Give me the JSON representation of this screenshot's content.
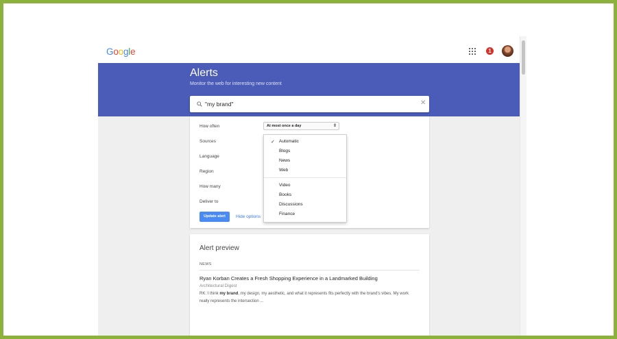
{
  "header": {
    "logo_letters": [
      {
        "char": "G",
        "color": "#4285f4"
      },
      {
        "char": "o",
        "color": "#ea4335"
      },
      {
        "char": "o",
        "color": "#fbbc05"
      },
      {
        "char": "g",
        "color": "#4285f4"
      },
      {
        "char": "l",
        "color": "#34a853"
      },
      {
        "char": "e",
        "color": "#ea4335"
      }
    ],
    "notification_count": "1",
    "icons": [
      "apps-grid-icon",
      "notification-badge",
      "account-avatar"
    ]
  },
  "banner": {
    "title": "Alerts",
    "subtitle": "Monitor the web for interesting new content",
    "color": "#4a5bb8"
  },
  "search": {
    "value": "\"my brand\"",
    "icon": "search-icon",
    "clear_icon": "close-icon"
  },
  "options": {
    "how_often_label": "How often",
    "how_often_value": "At most once a day",
    "sources_label": "Sources",
    "language_label": "Language",
    "region_label": "Region",
    "how_many_label": "How many",
    "deliver_to_label": "Deliver to",
    "update_button": "Update alert",
    "hide_options": "Hide options"
  },
  "sources_dropdown": {
    "selected": "Automatic",
    "items": [
      "Automatic",
      "Blogs",
      "News",
      "Web",
      "Video",
      "Books",
      "Discussions",
      "Finance"
    ]
  },
  "preview": {
    "title": "Alert preview",
    "section": "NEWS",
    "headline": "Ryan Korban Creates a Fresh Shopping Experience in a Landmarked Building",
    "source": "Architectural Digest",
    "snippet_before": "RK: I think ",
    "snippet_bold": "my brand",
    "snippet_after": ", my design, my aesthetic, and what it represents fits perfectly with the brand's vibes. My work really represents the intersection ..."
  },
  "colors": {
    "frame": "#8cb13c",
    "button": "#4a8af4",
    "link": "#3b78e7"
  }
}
